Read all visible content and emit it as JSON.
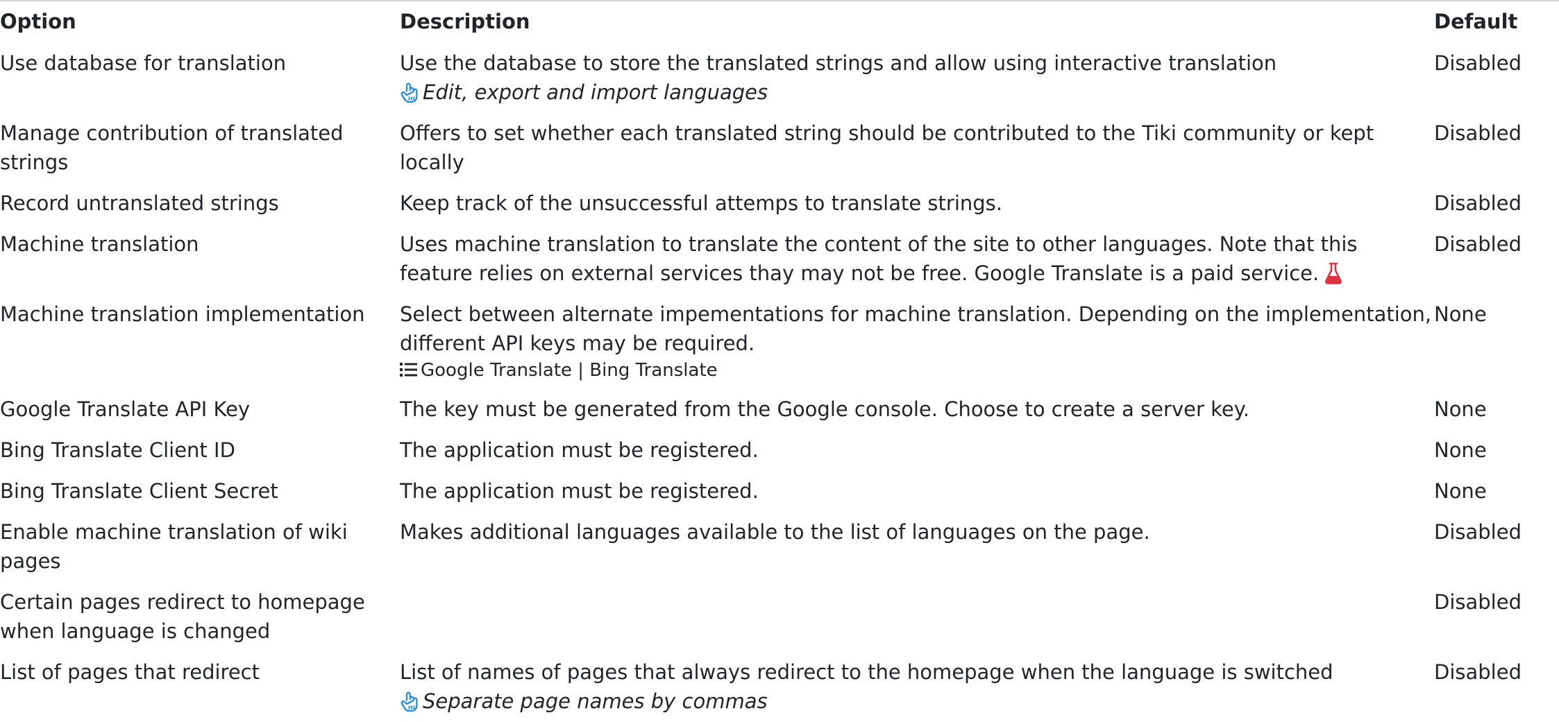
{
  "headers": {
    "option": "Option",
    "description": "Description",
    "default": "Default"
  },
  "rows": [
    {
      "option": "Use database for translation",
      "description": "Use the database to store the translated strings and allow using interactive translation",
      "hint": "Edit, export and import languages",
      "default": "Disabled"
    },
    {
      "option": "Manage contribution of translated strings",
      "description": "Offers to set whether each translated string should be contributed to the Tiki community or kept locally",
      "default": "Disabled"
    },
    {
      "option": "Record untranslated strings",
      "description": "Keep track of the unsuccessful attemps to translate strings.",
      "default": "Disabled"
    },
    {
      "option": "Machine translation",
      "description": "Uses machine translation to translate the content of the site to other languages. Note that this feature relies on external services thay may not be free. Google Translate is a paid service.",
      "experimental_icon": "flask-icon",
      "default": "Disabled"
    },
    {
      "option": "Machine translation implementation",
      "description": "Select between alternate impementations for machine translation. Depending on the implementation, different API keys may be required.",
      "choices": "Google Translate | Bing Translate",
      "default": "None"
    },
    {
      "option": "Google Translate API Key",
      "description": "The key must be generated from the Google console. Choose to create a server key.",
      "default": "None"
    },
    {
      "option": "Bing Translate Client ID",
      "description": "The application must be registered.",
      "default": "None"
    },
    {
      "option": "Bing Translate Client Secret",
      "description": "The application must be registered.",
      "default": "None"
    },
    {
      "option": "Enable machine translation of wiki pages",
      "description": "Makes additional languages available to the list of languages on the page.",
      "default": "Disabled"
    },
    {
      "option": "Certain pages redirect to homepage when language is changed",
      "description": "",
      "default": "Disabled"
    },
    {
      "option": "List of pages that redirect",
      "description": "List of names of pages that always redirect to the homepage when the language is switched",
      "hint": "Separate page names by commas",
      "default": "Disabled"
    }
  ],
  "colors": {
    "text": "#212529",
    "hint_icon": "#1e88e5",
    "experimental_icon": "#d9343f",
    "top_border": "#d6d6d6"
  }
}
